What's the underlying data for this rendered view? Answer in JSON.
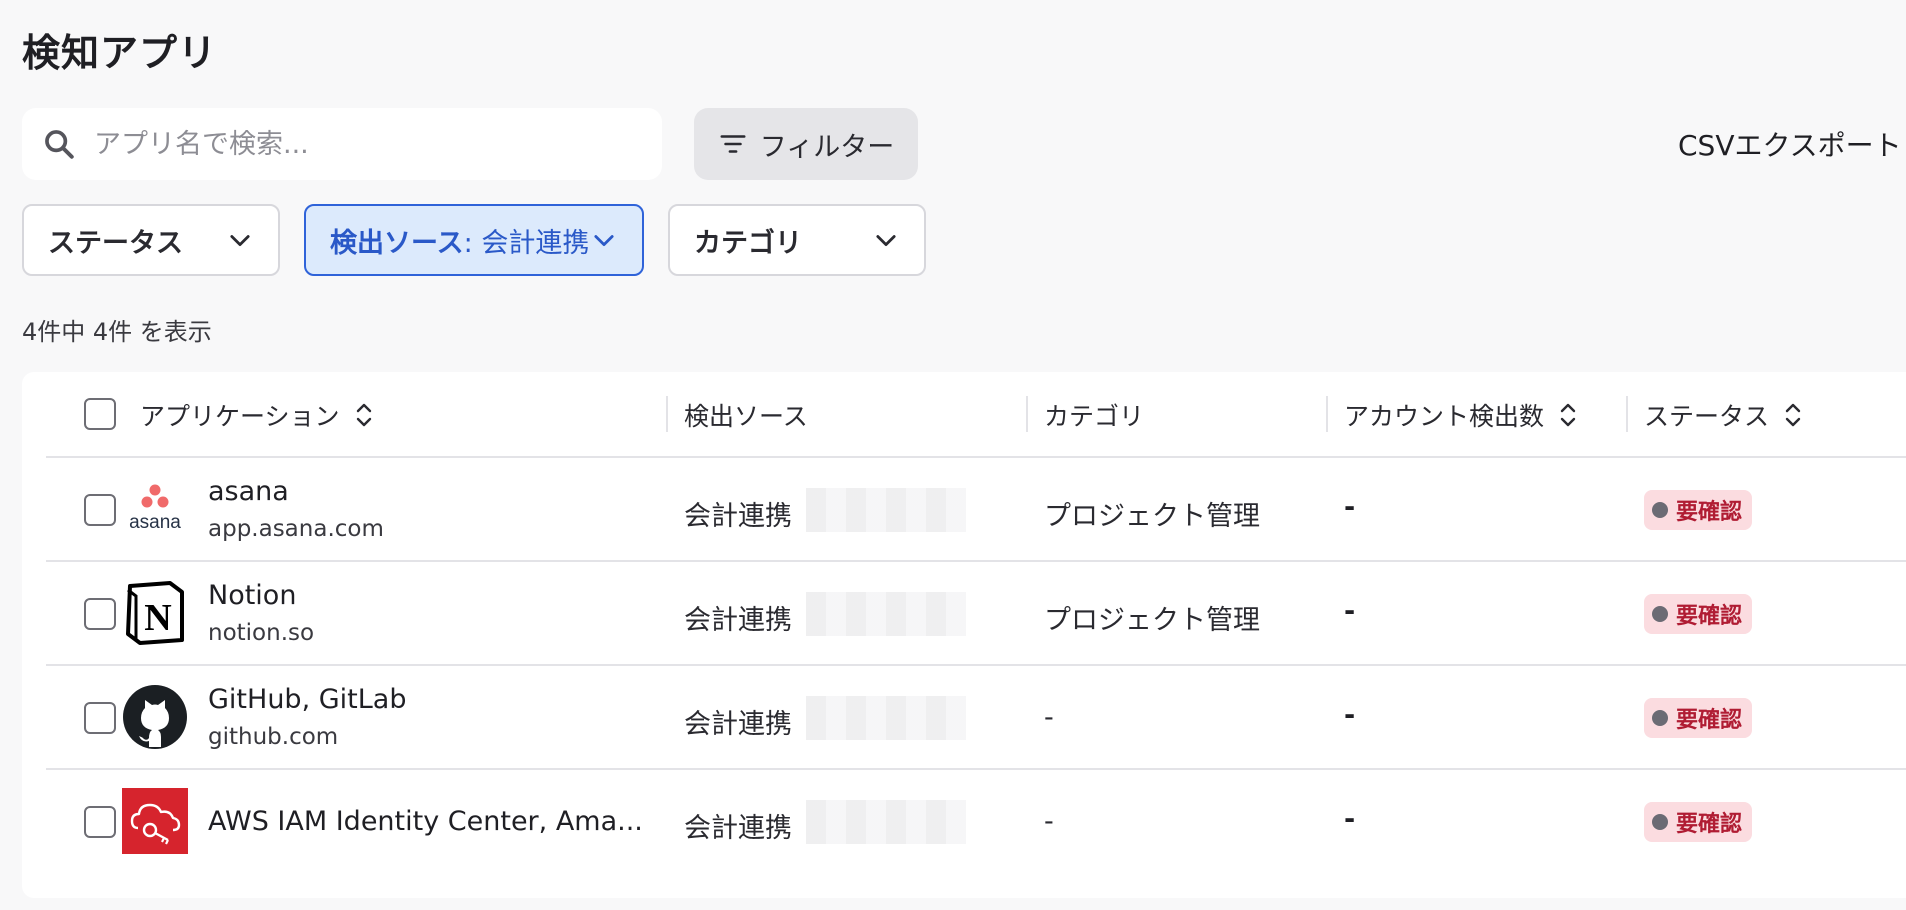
{
  "page": {
    "title": "検知アプリ"
  },
  "toolbar": {
    "search_placeholder": "アプリ名で検索...",
    "filter_label": "フィルター",
    "csv_export_label": "CSVエクスポート"
  },
  "filters": {
    "status_label": "ステータス",
    "source_key": "検出ソース",
    "source_value": ": 会計連携",
    "category_label": "カテゴリ"
  },
  "result_count": "4件中 4件 を表示",
  "table": {
    "columns": {
      "application": "アプリケーション",
      "source": "検出ソース",
      "category": "カテゴリ",
      "account_count": "アカウント検出数",
      "status": "ステータス"
    },
    "rows": [
      {
        "name": "asana",
        "domain": "app.asana.com",
        "logo": "asana-logo",
        "source": "会計連携",
        "category": "プロジェクト管理",
        "account_count": "-",
        "status": "要確認"
      },
      {
        "name": "Notion",
        "domain": "notion.so",
        "logo": "notion-logo",
        "source": "会計連携",
        "category": "プロジェクト管理",
        "account_count": "-",
        "status": "要確認"
      },
      {
        "name": "GitHub, GitLab",
        "domain": "github.com",
        "logo": "github-logo",
        "source": "会計連携",
        "category": "-",
        "account_count": "-",
        "status": "要確認"
      },
      {
        "name": "AWS IAM Identity Center, Ama...",
        "domain": "",
        "logo": "aws-iam-logo",
        "source": "会計連携",
        "category": "-",
        "account_count": "-",
        "status": "要確認"
      }
    ]
  },
  "colors": {
    "accent_blue": "#2a59c8",
    "status_badge_bg": "#fbdce0",
    "status_badge_text": "#b01c33"
  }
}
